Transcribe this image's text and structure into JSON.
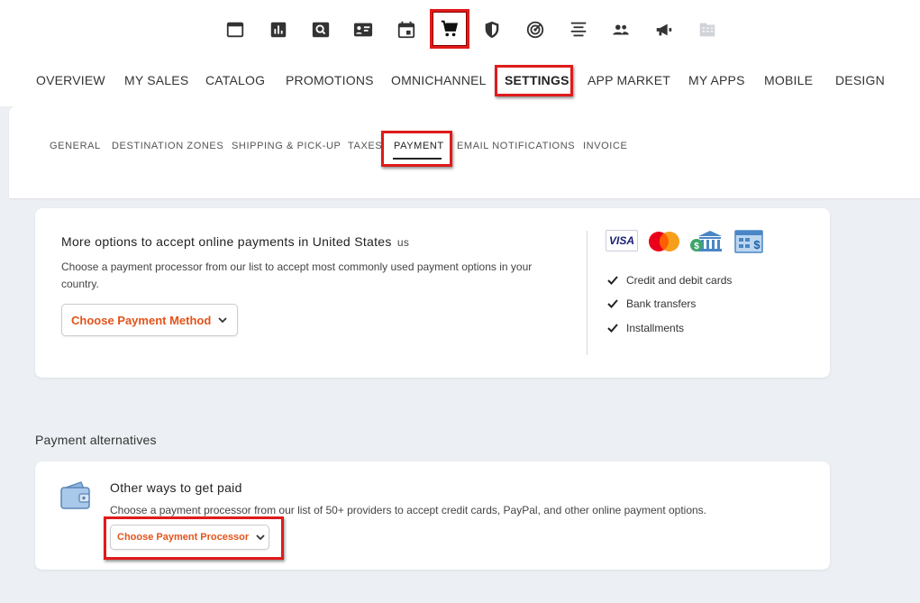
{
  "top_icons": [
    {
      "name": "browser-window-icon",
      "active": false
    },
    {
      "name": "bar-chart-icon",
      "active": false
    },
    {
      "name": "search-icon",
      "active": false
    },
    {
      "name": "contact-card-icon",
      "active": false
    },
    {
      "name": "calendar-icon",
      "active": false
    },
    {
      "name": "shopping-cart-icon",
      "active": true
    },
    {
      "name": "shield-icon",
      "active": false
    },
    {
      "name": "radar-icon",
      "active": false
    },
    {
      "name": "align-center-icon",
      "active": false
    },
    {
      "name": "people-icon",
      "active": false
    },
    {
      "name": "megaphone-icon",
      "active": false
    },
    {
      "name": "building-icon",
      "active": false
    }
  ],
  "main_nav": [
    {
      "label": "OVERVIEW",
      "active": false
    },
    {
      "label": "MY SALES",
      "active": false
    },
    {
      "label": "CATALOG",
      "active": false
    },
    {
      "label": "PROMOTIONS",
      "active": false
    },
    {
      "label": "OMNICHANNEL",
      "active": false
    },
    {
      "label": "SETTINGS",
      "active": true
    },
    {
      "label": "APP MARKET",
      "active": false
    },
    {
      "label": "MY APPS",
      "active": false
    },
    {
      "label": "MOBILE",
      "active": false
    },
    {
      "label": "DESIGN",
      "active": false
    }
  ],
  "sub_nav": [
    {
      "label": "GENERAL",
      "active": false
    },
    {
      "label": "DESTINATION ZONES",
      "active": false
    },
    {
      "label": "SHIPPING & PICK-UP",
      "active": false
    },
    {
      "label": "TAXES",
      "active": false
    },
    {
      "label": "PAYMENT",
      "active": true
    },
    {
      "label": "EMAIL NOTIFICATIONS",
      "active": false
    },
    {
      "label": "INVOICE",
      "active": false
    }
  ],
  "online_payments": {
    "title": "More options to accept online payments in United States",
    "country_code": "us",
    "description": "Choose a payment processor from our list to accept most commonly used payment options in your country.",
    "button_label": "Choose Payment Method",
    "logos": [
      "visa-logo",
      "mastercard-logo",
      "bank-logo",
      "invoice-logo"
    ],
    "visa_text": "VISA",
    "features": [
      "Credit and debit cards",
      "Bank transfers",
      "Installments"
    ]
  },
  "alternatives": {
    "section_title": "Payment alternatives",
    "card_title": "Other ways to get paid",
    "description": "Choose a payment processor from our list of 50+ providers to accept credit cards, PayPal, and other online payment options.",
    "button_label": "Choose Payment Processor"
  },
  "colors": {
    "accent_orange": "#e3531b",
    "highlight_red": "#e01b1b",
    "background_grey": "#eceff3",
    "visa_blue": "#1a1f71",
    "mastercard_red": "#eb001b",
    "mastercard_orange": "#f79e1b",
    "bank_blue": "#4a86c5",
    "dollar_green": "#3ea56b"
  }
}
